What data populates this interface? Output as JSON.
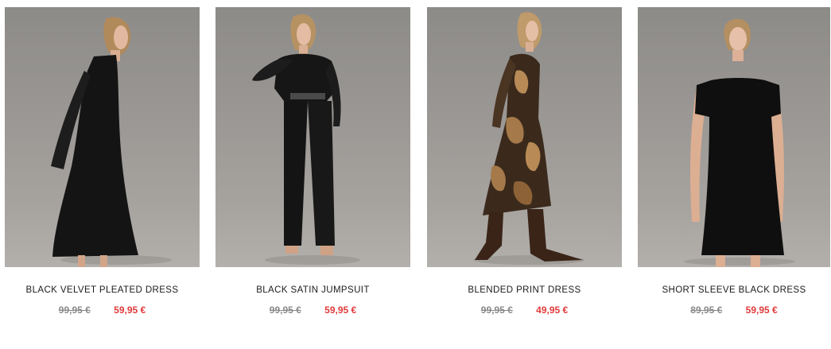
{
  "products": [
    {
      "title": "BLACK VELVET PLEATED DRESS",
      "old_price": "99,95 €",
      "new_price": "59,95 €",
      "photo_icon": "model-in-black-pleated-dress"
    },
    {
      "title": "BLACK SATIN JUMPSUIT",
      "old_price": "99,95 €",
      "new_price": "59,95 €",
      "photo_icon": "model-in-black-satin-jumpsuit"
    },
    {
      "title": "BLENDED PRINT DRESS",
      "old_price": "99,95 €",
      "new_price": "49,95 €",
      "photo_icon": "model-in-print-dress"
    },
    {
      "title": "SHORT SLEEVE BLACK DRESS",
      "old_price": "89,95 €",
      "new_price": "59,95 €",
      "photo_icon": "model-in-short-sleeve-dress"
    }
  ],
  "colors": {
    "sale_red": "#e03a3a",
    "old_price_grey": "#8a8a8a",
    "photo_backdrop": "#9b9895"
  }
}
